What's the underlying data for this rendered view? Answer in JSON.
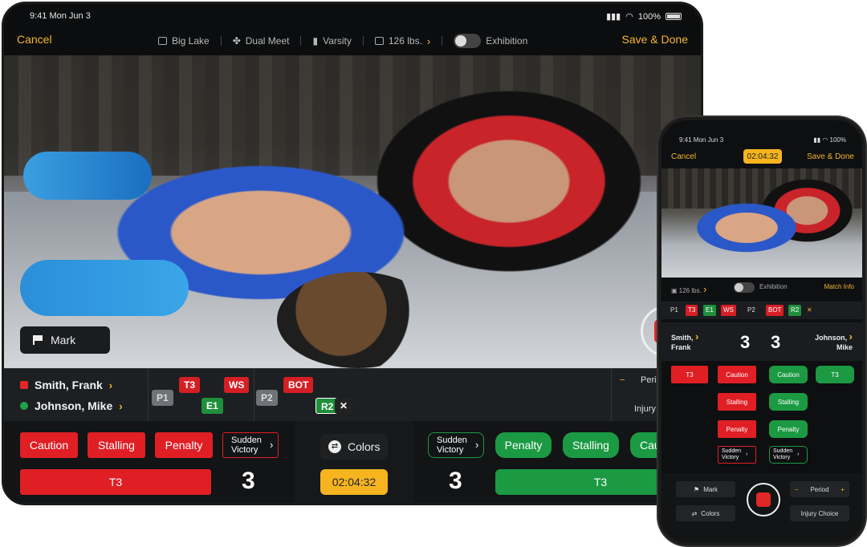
{
  "status": {
    "time": "9:41  Mon Jun 3",
    "battery": "100%"
  },
  "nav": {
    "cancel": "Cancel",
    "save": "Save & Done",
    "location": "Big Lake",
    "event_type": "Dual Meet",
    "level": "Varsity",
    "weight": "126 lbs.",
    "exhibition": "Exhibition"
  },
  "video": {
    "mark": "Mark"
  },
  "wrestlers": {
    "red": {
      "name": "Smith, Frank",
      "score": "3"
    },
    "green": {
      "name": "Johnson, Mike",
      "score": "3"
    }
  },
  "periods": {
    "p1": "P1",
    "p2": "P2",
    "red_chips": [
      "T3",
      "WS"
    ],
    "green_chips": [
      "E1"
    ],
    "p2_red": "BOT",
    "p2_green": "R2",
    "remove": "✕",
    "period_label": "Peric",
    "injury_label": "Injury C"
  },
  "actions": {
    "caution": "Caution",
    "stalling": "Stalling",
    "penalty": "Penalty",
    "sudden_line1": "Sudden",
    "sudden_line2": "Victory",
    "t3": "T3",
    "colors": "Colors",
    "timer": "02:04:32",
    "caution_cut": "Cau"
  },
  "phone": {
    "time": "9:41  Mon Jun 3",
    "battery": "100%",
    "cancel": "Cancel",
    "timer": "02:04:32",
    "save": "Save & Done",
    "weight": "126 lbs.",
    "exhibition": "Exhibition",
    "match_info": "Match Info",
    "chips": {
      "p1": "P1",
      "t3": "T3",
      "e1": "E1",
      "ws": "WS",
      "p2": "P2",
      "bot": "BOT",
      "r2": "R2",
      "x": "✕"
    },
    "red_name_1": "Smith,",
    "red_name_2": "Frank",
    "green_name_1": "Johnson,",
    "green_name_2": "Mike",
    "red_score": "3",
    "green_score": "3",
    "t3": "T3",
    "caution": "Caution",
    "stalling": "Stalling",
    "penalty": "Penalty",
    "sudden_1": "Sudden",
    "sudden_2": "Victory",
    "mark": "Mark",
    "colors": "Colors",
    "period": "Period",
    "minus": "−",
    "plus": "+",
    "injury": "Injury Choice"
  },
  "colors": {
    "accent": "#f5b730",
    "red": "#e01f25",
    "green": "#1b9a43",
    "timer": "#f6b51f"
  }
}
